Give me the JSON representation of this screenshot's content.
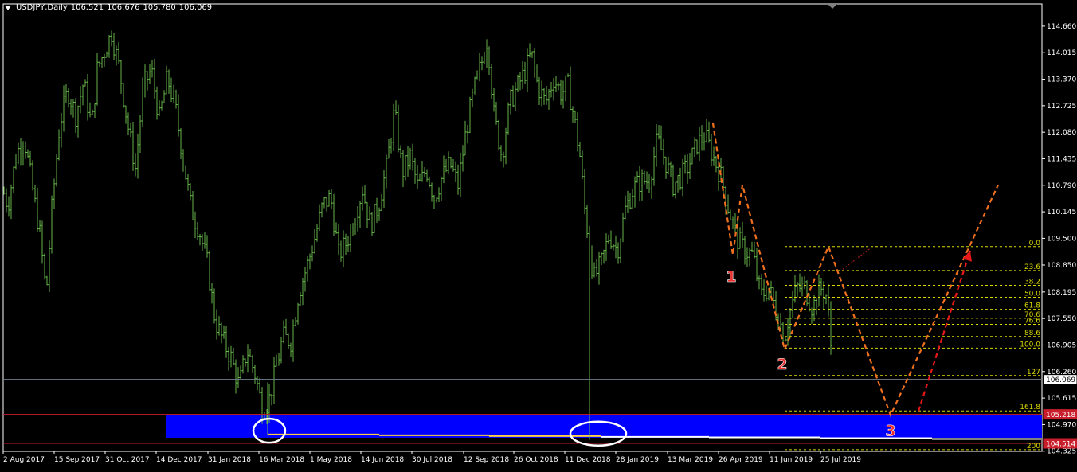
{
  "header": {
    "symbol": "USDJPY,Daily",
    "open": "106.521",
    "high": "106.676",
    "low": "105.780",
    "close": "106.069"
  },
  "chart_data": {
    "type": "bar",
    "title": "USDJPY,Daily",
    "ylim": [
      104.32,
      115.2
    ],
    "y_ticks": [
      "114.660",
      "114.015",
      "113.370",
      "112.725",
      "112.080",
      "111.435",
      "110.790",
      "110.145",
      "109.500",
      "108.850",
      "108.195",
      "107.550",
      "106.905",
      "106.260",
      "105.615",
      "104.970",
      "104.325"
    ],
    "x_ticks": [
      "2 Aug 2017",
      "15 Sep 2017",
      "31 Oct 2017",
      "14 Dec 2017",
      "31 Jan 2018",
      "16 Mar 2018",
      "1 May 2018",
      "14 Jun 2018",
      "30 Jul 2018",
      "12 Sep 2018",
      "26 Oct 2018",
      "11 Dec 2018",
      "28 Jan 2019",
      "13 Mar 2019",
      "26 Apr 2019",
      "11 Jun 2019",
      "25 Jul 2019"
    ],
    "price_path": [
      [
        0,
        110.9
      ],
      [
        10,
        110.3
      ],
      [
        20,
        111.5
      ],
      [
        30,
        112.0
      ],
      [
        40,
        110.8
      ],
      [
        50,
        109.6
      ],
      [
        58,
        108.1
      ],
      [
        65,
        110.2
      ],
      [
        75,
        112.3
      ],
      [
        85,
        113.1
      ],
      [
        95,
        112.5
      ],
      [
        105,
        113.3
      ],
      [
        115,
        112.2
      ],
      [
        122,
        113.6
      ],
      [
        130,
        114.0
      ],
      [
        140,
        114.5
      ],
      [
        150,
        113.6
      ],
      [
        160,
        112.3
      ],
      [
        170,
        111.2
      ],
      [
        180,
        113.2
      ],
      [
        190,
        113.6
      ],
      [
        200,
        112.4
      ],
      [
        210,
        113.4
      ],
      [
        220,
        112.7
      ],
      [
        230,
        111.4
      ],
      [
        240,
        110.2
      ],
      [
        250,
        109.7
      ],
      [
        260,
        108.9
      ],
      [
        270,
        107.5
      ],
      [
        280,
        107.0
      ],
      [
        290,
        106.6
      ],
      [
        300,
        105.9
      ],
      [
        310,
        106.8
      ],
      [
        320,
        106.2
      ],
      [
        330,
        105.3
      ],
      [
        338,
        105.6
      ],
      [
        345,
        106.2
      ],
      [
        355,
        107.1
      ],
      [
        365,
        107.0
      ],
      [
        375,
        108.2
      ],
      [
        385,
        108.8
      ],
      [
        395,
        109.5
      ],
      [
        405,
        110.3
      ],
      [
        415,
        110.5
      ],
      [
        425,
        109.1
      ],
      [
        435,
        109.4
      ],
      [
        445,
        110.0
      ],
      [
        455,
        110.7
      ],
      [
        465,
        109.8
      ],
      [
        475,
        110.3
      ],
      [
        485,
        111.2
      ],
      [
        495,
        112.6
      ],
      [
        505,
        111.1
      ],
      [
        515,
        111.5
      ],
      [
        525,
        110.7
      ],
      [
        535,
        111.2
      ],
      [
        545,
        110.5
      ],
      [
        555,
        111.0
      ],
      [
        565,
        111.3
      ],
      [
        575,
        110.8
      ],
      [
        585,
        112.1
      ],
      [
        595,
        113.1
      ],
      [
        605,
        113.8
      ],
      [
        612,
        114.4
      ],
      [
        620,
        112.5
      ],
      [
        630,
        111.5
      ],
      [
        640,
        112.8
      ],
      [
        650,
        113.2
      ],
      [
        660,
        113.6
      ],
      [
        667,
        114.0
      ],
      [
        675,
        113.2
      ],
      [
        685,
        112.8
      ],
      [
        695,
        113.4
      ],
      [
        705,
        113.0
      ],
      [
        712,
        113.3
      ],
      [
        720,
        112.5
      ],
      [
        728,
        111.5
      ],
      [
        735,
        110.0
      ],
      [
        740,
        109.4
      ],
      [
        745,
        108.5
      ],
      [
        755,
        108.9
      ],
      [
        765,
        109.6
      ],
      [
        775,
        109.2
      ],
      [
        785,
        110.2
      ],
      [
        795,
        110.7
      ],
      [
        805,
        110.9
      ],
      [
        815,
        110.9
      ],
      [
        825,
        111.9
      ],
      [
        835,
        111.4
      ],
      [
        845,
        110.8
      ],
      [
        855,
        111.0
      ],
      [
        865,
        111.3
      ],
      [
        875,
        111.8
      ],
      [
        885,
        112.0
      ],
      [
        895,
        111.5
      ],
      [
        905,
        111.0
      ],
      [
        915,
        110.2
      ],
      [
        925,
        109.5
      ],
      [
        935,
        109.2
      ],
      [
        945,
        109.1
      ],
      [
        955,
        108.1
      ],
      [
        965,
        108.3
      ],
      [
        975,
        107.7
      ],
      [
        985,
        107.1
      ],
      [
        990,
        107.6
      ],
      [
        1000,
        108.3
      ],
      [
        1010,
        108.3
      ],
      [
        1020,
        107.8
      ],
      [
        1030,
        108.3
      ],
      [
        1038,
        108.1
      ],
      [
        1043,
        106.9
      ],
      [
        1045,
        106.1
      ]
    ],
    "spikes": [
      {
        "x": 336,
        "hi": 106.0,
        "lo": 104.7
      },
      {
        "x": 740,
        "hi": 109.8,
        "lo": 104.6
      }
    ],
    "current_price": 106.069,
    "upper_line_price": 105.218,
    "lower_line_price": 104.514,
    "zone": {
      "x_start": 209,
      "top": 105.218,
      "bottom": 104.65
    },
    "zone_steps": [
      [
        336,
        104.73
      ],
      [
        476,
        104.71
      ],
      [
        614,
        104.69
      ],
      [
        755,
        104.67
      ],
      [
        890,
        104.66
      ],
      [
        1030,
        104.64
      ],
      [
        1170,
        104.62
      ],
      [
        1307,
        104.61
      ]
    ],
    "fib": {
      "x_start": 985,
      "price_0": 109.3,
      "price_100": 106.83,
      "levels": [
        "0.0",
        "23.6",
        "38.2",
        "50.0",
        "61.8",
        "70.6",
        "76.6",
        "88.6",
        "100.0",
        "127",
        "161.8",
        "200"
      ],
      "ratios": [
        0,
        0.236,
        0.382,
        0.5,
        0.618,
        0.706,
        0.766,
        0.886,
        1.0,
        1.27,
        1.618,
        2.0
      ]
    },
    "wave_path": [
      [
        895,
        112.3
      ],
      [
        920,
        109.1
      ],
      [
        932,
        110.8
      ],
      [
        985,
        106.8
      ],
      [
        1040,
        109.3
      ],
      [
        1118,
        105.2
      ],
      [
        1253,
        110.8
      ]
    ],
    "red_arrow": {
      "from": [
        1153,
        105.3
      ],
      "to": [
        1218,
        109.2
      ]
    },
    "red_thin": {
      "from": [
        1058,
        108.75
      ],
      "to": [
        1092,
        109.25
      ]
    },
    "markers": [
      {
        "text": "1",
        "x": 918,
        "price": 108.6
      },
      {
        "text": "2",
        "x": 982,
        "price": 106.47
      },
      {
        "text": "3",
        "x": 1118,
        "price": 104.85
      }
    ],
    "ellipses": [
      {
        "x": 338,
        "price": 104.82,
        "rx": 20,
        "ry": 15
      },
      {
        "x": 751,
        "price": 104.75,
        "rx": 35,
        "ry": 15
      }
    ],
    "price_labels": {
      "current": "106.069",
      "upper": "105.218",
      "lower": "104.514"
    },
    "colors": {
      "bars": "#66b54a",
      "zone": "#0000ff",
      "fib": "#d8d800",
      "wave": "#f07020",
      "marker": "#e83030",
      "current_line": "#708090",
      "upper_line": "#c81e2c",
      "lower_line": "#c81e2c",
      "label_red": "#c81e2c"
    }
  }
}
